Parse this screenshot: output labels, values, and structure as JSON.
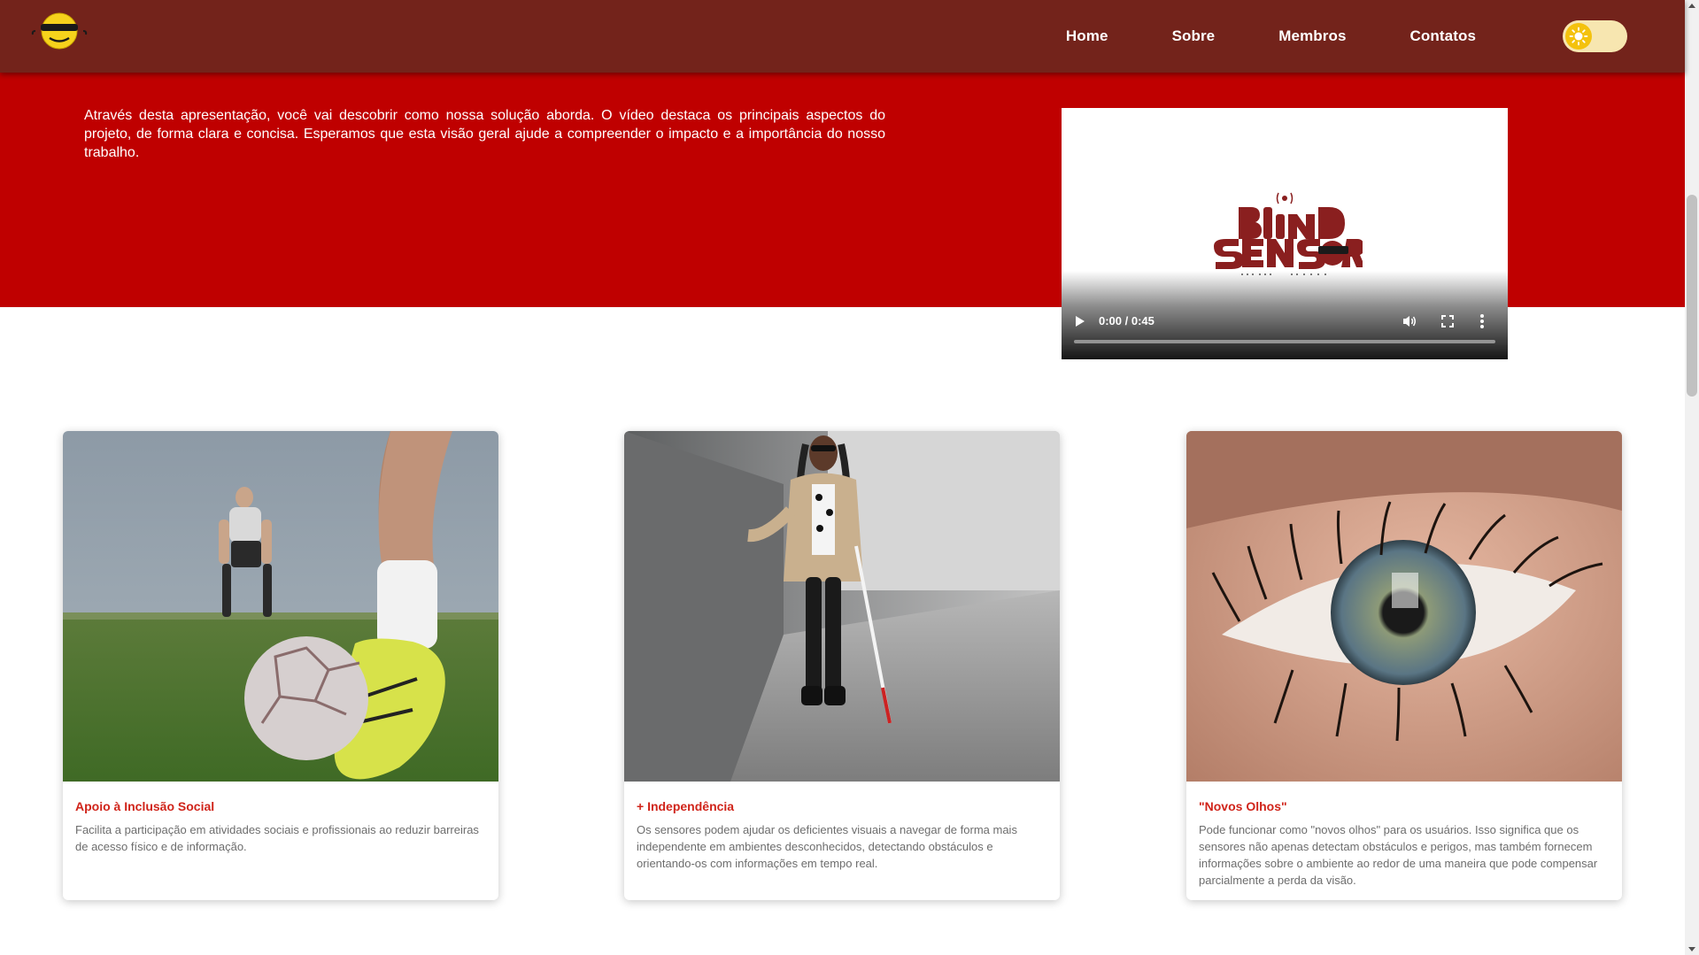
{
  "navbar": {
    "logo_icon": "sunglasses-smiley-logo",
    "links": [
      {
        "label": "Home"
      },
      {
        "label": "Sobre"
      },
      {
        "label": "Membros"
      },
      {
        "label": "Contatos"
      }
    ],
    "theme_toggle_icon": "sun-icon",
    "colors": {
      "background": "#73231b",
      "toggle_track": "#f7e6b0",
      "toggle_knob": "#f4c20d"
    }
  },
  "hero": {
    "text": "Através desta apresentação, você vai descobrir como nossa solução aborda. O vídeo destaca os principais aspectos do projeto, de forma clara e concisa. Esperamos que esta visão geral ajude a compreender o impacto e a importância do nosso trabalho.",
    "background": "#bf0000"
  },
  "video": {
    "logo": "blind-sensor-logo",
    "time": "0:00 / 0:45",
    "progress": 0
  },
  "cards": [
    {
      "image": "soccer-player-kicking-ball-photo",
      "title": "Apoio à Inclusão Social",
      "text": "Facilita a participação em atividades sociais e profissionais ao reduzir barreiras de acesso físico e de informação."
    },
    {
      "image": "woman-with-white-cane-walking-photo",
      "title": "+ Independência",
      "text": "Os sensores podem ajudar os deficientes visuais a navegar de forma mais independente em ambientes desconhecidos, detectando obstáculos e orientando-os com informações em tempo real."
    },
    {
      "image": "eye-closeup-photo",
      "title": "\"Novos Olhos\"",
      "text": "Pode funcionar como \"novos olhos\" para os usuários. Isso significa que os sensores não apenas detectam obstáculos e perigos, mas também fornecem informações sobre o ambiente ao redor de uma maneira que pode compensar parcialmente a perda da visão."
    }
  ],
  "accent_color": "#d0241a"
}
